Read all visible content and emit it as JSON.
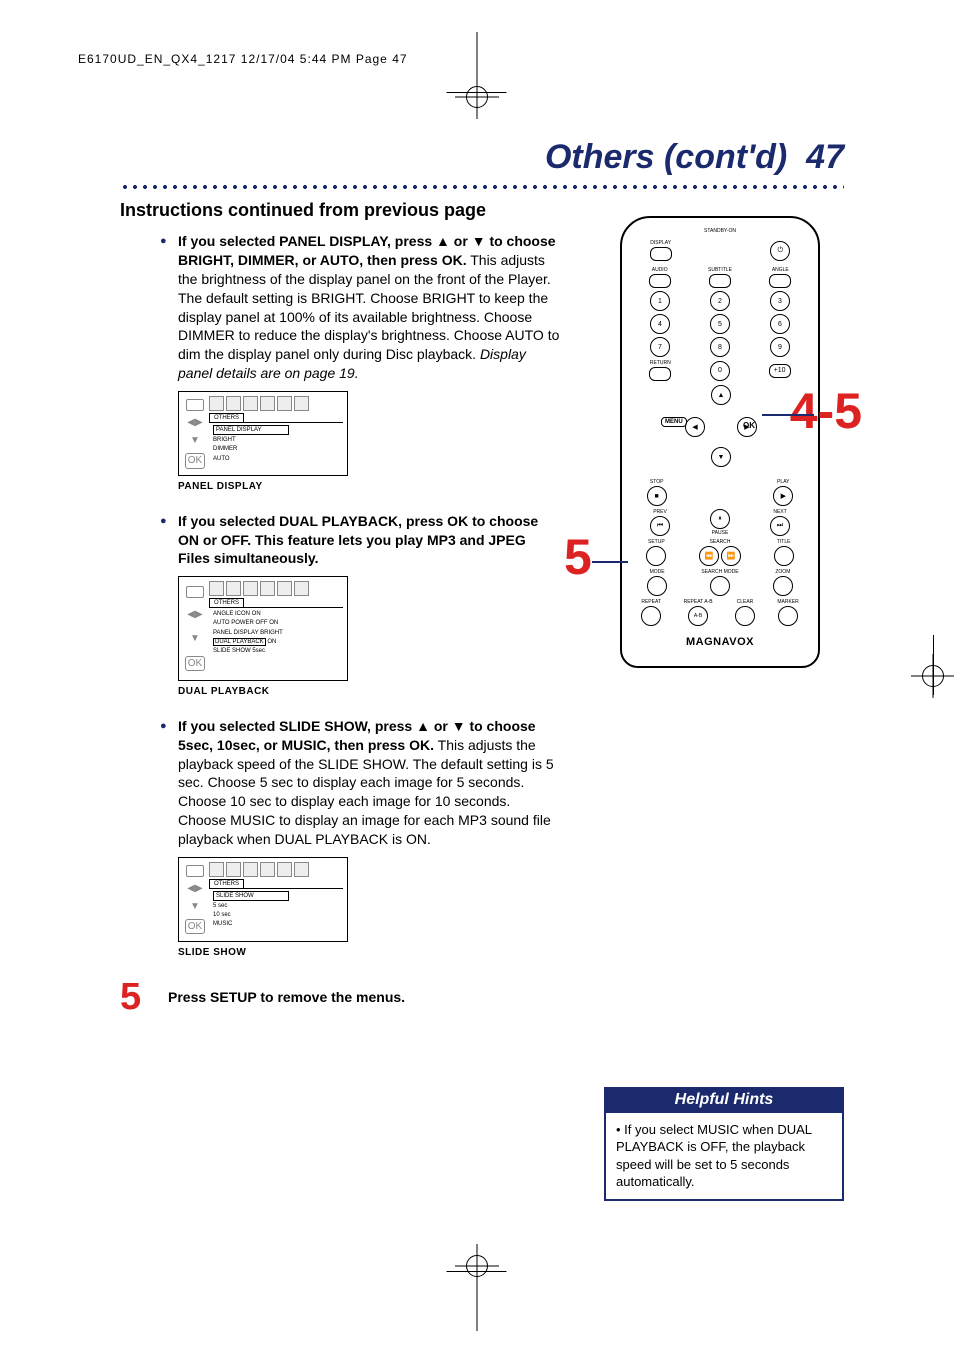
{
  "print_header": "E6170UD_EN_QX4_1217  12/17/04  5:44 PM  Page 47",
  "page_title_text": "Others (cont'd)",
  "page_number": "47",
  "section_heading": "Instructions continued from previous page",
  "instructions": {
    "panel_display": {
      "lead_bold": "If you selected PANEL DISPLAY, press ▲ or ▼ to choose BRIGHT, DIMMER, or AUTO, then press OK.",
      "body": " This adjusts the brightness of the display panel on the front of the Player. The default setting is BRIGHT. Choose BRIGHT to keep the display panel at 100% of its available brightness. Choose DIMMER to reduce the display's brightness. Choose AUTO to dim the display panel only during Disc playback. ",
      "italic_tail": "Display panel details are on page 19.",
      "osd": {
        "tab": "OTHERS",
        "rows": [
          "PANEL DISPLAY",
          "BRIGHT",
          "DIMMER",
          "AUTO"
        ],
        "selected": "PANEL DISPLAY"
      },
      "caption": "PANEL DISPLAY"
    },
    "dual_playback": {
      "lead_bold": "If you selected DUAL PLAYBACK, press OK to choose ON or OFF.  This feature lets you play MP3 and JPEG Files simultaneously.",
      "osd": {
        "tab": "OTHERS",
        "rows": [
          "ANGLE ICON        ON",
          "AUTO POWER OFF  ON",
          "PANEL DISPLAY   BRIGHT",
          "DUAL PLAYBACK   ON",
          "SLIDE SHOW        5sec"
        ],
        "selected": "DUAL PLAYBACK"
      },
      "caption": "DUAL PLAYBACK"
    },
    "slide_show": {
      "lead_bold": "If you selected SLIDE SHOW, press ▲ or ▼ to choose 5sec, 10sec, or MUSIC, then press OK.",
      "body": " This adjusts the playback speed of the SLIDE SHOW. The default setting is 5 sec. Choose 5 sec to display each image for 5 seconds. Choose 10 sec to display each image for 10 seconds. Choose MUSIC to display an image for each MP3 sound file playback when DUAL PLAYBACK is ON.",
      "osd": {
        "tab": "OTHERS",
        "rows": [
          "SLIDE SHOW",
          "5 sec",
          "10 sec",
          "MUSIC"
        ],
        "selected": "SLIDE SHOW"
      },
      "caption": "SLIDE SHOW"
    }
  },
  "step5": {
    "num": "5",
    "text": "Press SETUP to remove the menus."
  },
  "remote": {
    "brand": "MAGNAVOX",
    "top_label": "STANDBY-ON",
    "buttons": {
      "display": "DISPLAY",
      "audio": "AUDIO",
      "subtitle": "SUBTITLE",
      "angle": "ANGLE",
      "digits": [
        "1",
        "2",
        "3",
        "4",
        "5",
        "6",
        "7",
        "8",
        "9",
        "0",
        "+10"
      ],
      "return": "RETURN",
      "ok": "OK",
      "menu": "MENU",
      "stop": "STOP",
      "play": "PLAY",
      "prev": "PREV",
      "pause": "PAUSE",
      "next": "NEXT",
      "setup": "SETUP",
      "search": "SEARCH",
      "title": "TITLE",
      "mode": "MODE",
      "search_mode": "SEARCH MODE",
      "zoom": "ZOOM",
      "repeat": "REPEAT",
      "repeat_ab": "REPEAT A-B",
      "clear": "CLEAR",
      "marker": "MARKER"
    },
    "callouts": {
      "ok_cluster": "4-5",
      "setup": "5"
    }
  },
  "hints": {
    "title": "Helpful Hints",
    "items": [
      "If you select MUSIC when DUAL PLAYBACK is OFF, the playback speed will be set to 5 seconds automatically."
    ]
  }
}
